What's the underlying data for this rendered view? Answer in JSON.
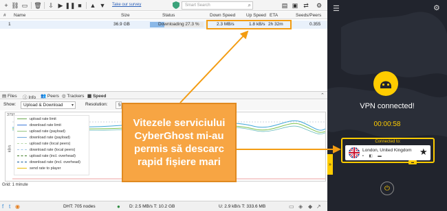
{
  "client": {
    "toolbar": {
      "survey_link": "Take our survey",
      "search_placeholder": "Smart Search"
    },
    "columns": [
      "#",
      "Name",
      "Size",
      "Status",
      "Down Speed",
      "Up Speed",
      "ETA",
      "Seeds/Peers"
    ],
    "torrents": [
      {
        "index": "1",
        "size": "36.9 GB",
        "progress": 0.273,
        "status": "Downloading 27.3 %",
        "down_speed": "2.3 MB/s",
        "up_speed": "1.8 kB/s",
        "eta": "2h 32m",
        "seeds_peers": "0.355"
      }
    ],
    "tabs": [
      "Files",
      "Info",
      "Peers",
      "Trackers",
      "Speed"
    ],
    "active_tab": "Speed",
    "show_label": "Show:",
    "show_value": "Upload & Download",
    "resolution_label": "Resolution:",
    "resolution_value": "5",
    "graph": {
      "y_top": "3791",
      "y_unit": "kB/s",
      "legend": [
        "upload rate limit",
        "download rate limit",
        "upload rate (payload)",
        "download rate (payload)",
        "upload rate (local peers)",
        "download rate (local peers)",
        "upload rate (incl. overhead)",
        "download rate (incl. overhead)",
        "send rate to player"
      ],
      "grid_label": "Grid: 1 minute"
    },
    "status": {
      "dht": "DHT: 705 nodes",
      "down": "D: 2.5 MB/s T: 10.2 GB",
      "up": "U: 2.9 kB/s T: 333.6 MB"
    }
  },
  "callout": {
    "text": "Vitezele serviciului CyberGhost mi-au permis să descarc rapid fișiere mari"
  },
  "vpn": {
    "status": "VPN connected!",
    "timer": "00:00:58",
    "connected_to_label": "Connected to:",
    "location": "London, United Kingdom",
    "colors": {
      "accent": "#ffcc00",
      "background": "#21242d",
      "callout": "#f7a543"
    }
  }
}
